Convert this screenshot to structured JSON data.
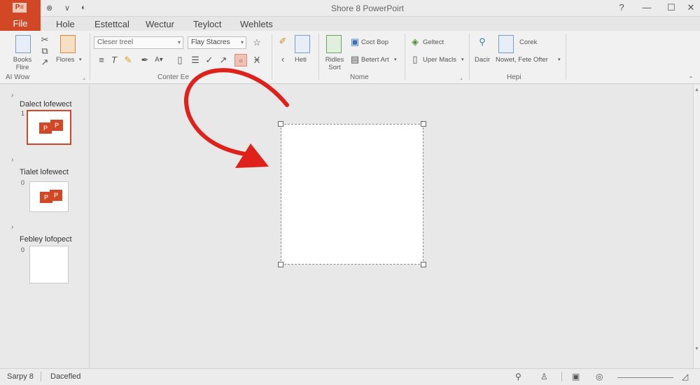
{
  "app": {
    "logo_text": "P≡",
    "window_title": "Shore 8 PowerPoirt"
  },
  "quick_access": [
    "⊗",
    "∨",
    "◐"
  ],
  "window_controls": [
    "?",
    "—",
    "☐",
    "✕"
  ],
  "tabs": [
    {
      "label": "File"
    },
    {
      "label": "Hole"
    },
    {
      "label": "Estettcal"
    },
    {
      "label": "Wectur"
    },
    {
      "label": "Teyloct"
    },
    {
      "label": "Wehlets"
    }
  ],
  "ribbon": {
    "group1": {
      "btn1_label": "Books Flire",
      "btn2_label": "Flores",
      "label": "AI Wow"
    },
    "group2": {
      "font_placeholder": "Cleser treel",
      "font_style_value": "Flay Stacres",
      "label": "Conter Ee"
    },
    "group3": {
      "btn_label": "Heti"
    },
    "group4": {
      "btn1_label": "Ridles Sort",
      "btn2_label": "Coct Bop",
      "btn3_label": "Betert Art",
      "label": "Nome"
    },
    "group5": {
      "btn1_label": "Geltect",
      "btn2_label": "Uper Macls"
    },
    "group6": {
      "btn1_label": "Dacir",
      "btn2_label": "Corek",
      "btn3_label": "Nowet, Fete Ofter",
      "label": "Hepi"
    }
  },
  "slides": [
    {
      "title": "Dalect lofewect",
      "number": "1"
    },
    {
      "title": "Tialet lofewect",
      "number": "0"
    },
    {
      "title": "Febley lofopect",
      "number": "0"
    }
  ],
  "status": {
    "slide_info": "Sarpy 8",
    "accessibility": "Dacefled"
  },
  "colors": {
    "accent": "#d24726",
    "arrow": "#e0211b"
  }
}
